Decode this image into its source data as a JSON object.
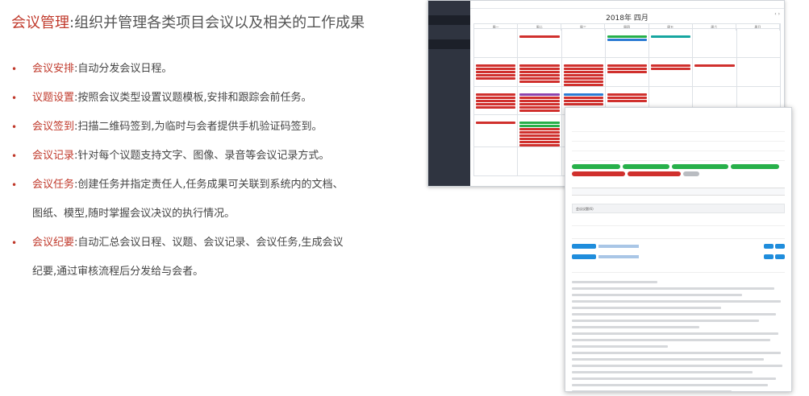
{
  "heading": {
    "keyword": "会议管理",
    "separator": ":",
    "description": "组织并管理各类项目会议以及相关的工作成果"
  },
  "features": [
    {
      "bullet": "•",
      "name": "会议安排",
      "sep": ":",
      "text": "自动分发会议日程。",
      "cont": ""
    },
    {
      "bullet": "•",
      "name": "议题设置",
      "sep": ":",
      "text": "按照会议类型设置议题模板,安排和跟踪会前任务。",
      "cont": ""
    },
    {
      "bullet": "•",
      "name": "会议签到",
      "sep": ":",
      "text": "扫描二维码签到,为临时与会者提供手机验证码签到。",
      "cont": ""
    },
    {
      "bullet": "•",
      "name": "会议记录",
      "sep": ":",
      "text": "针对每个议题支持文字、图像、录音等会议记录方式。",
      "cont": ""
    },
    {
      "bullet": "•",
      "name": "会议任务",
      "sep": ":",
      "text": "创建任务并指定责任人,任务成果可关联到系统内的文档、",
      "cont": "图纸、模型,随时掌握会议决议的执行情况。"
    },
    {
      "bullet": "•",
      "name": "会议纪要",
      "sep": ":",
      "text": "自动汇总会议日程、议题、会议记录、会议任务,生成会议",
      "cont": "纪要,通过审核流程后分发给与会者。"
    }
  ],
  "calendar": {
    "title": "2018年 四月",
    "weekdays": [
      "周一",
      "周二",
      "周三",
      "周四",
      "周五",
      "周六",
      "周日"
    ],
    "colors": {
      "red": "#d0302d",
      "green": "#27b04a",
      "blue": "#2b7bd3",
      "teal": "#16a6a0",
      "purple": "#8e44ad"
    }
  },
  "detail": {
    "section_title": "会议议题(6)"
  }
}
